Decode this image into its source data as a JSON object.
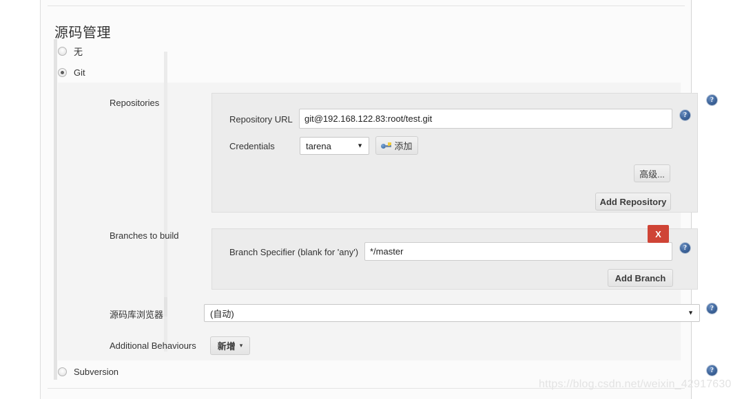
{
  "section": {
    "title": "源码管理"
  },
  "scm_options": [
    {
      "label": "无",
      "selected": false
    },
    {
      "label": "Git",
      "selected": true
    },
    {
      "label": "Subversion",
      "selected": false
    }
  ],
  "repositories": {
    "row_label": "Repositories",
    "url_field": {
      "label": "Repository URL",
      "value": "git@192.168.122.83:root/test.git"
    },
    "credentials_field": {
      "label": "Credentials",
      "value": "tarena",
      "caret": "▼",
      "add_button": "添加",
      "add_button_icon": "key-icon"
    },
    "advanced_button": "高级...",
    "add_repository_button": "Add Repository"
  },
  "branches": {
    "row_label": "Branches to build",
    "specifier_field": {
      "label": "Branch Specifier (blank for 'any')",
      "value": "*/master"
    },
    "delete_button": "X",
    "add_branch_button": "Add Branch"
  },
  "repository_browser": {
    "row_label": "源码库浏览器",
    "value": "(自动)",
    "caret": "▼"
  },
  "additional_behaviours": {
    "row_label": "Additional Behaviours",
    "add_button": "新增",
    "caret": "▾"
  },
  "help_icons": {
    "glyph": "?"
  },
  "watermark": {
    "text": "https://blog.csdn.net/weixin_42917630"
  },
  "colors": {
    "danger": "#cf4436",
    "help_blue": "#3c6399",
    "panel_bg": "#fbfbfb",
    "block_bg": "#f4f4f4",
    "inner_box_bg": "#ececec"
  }
}
